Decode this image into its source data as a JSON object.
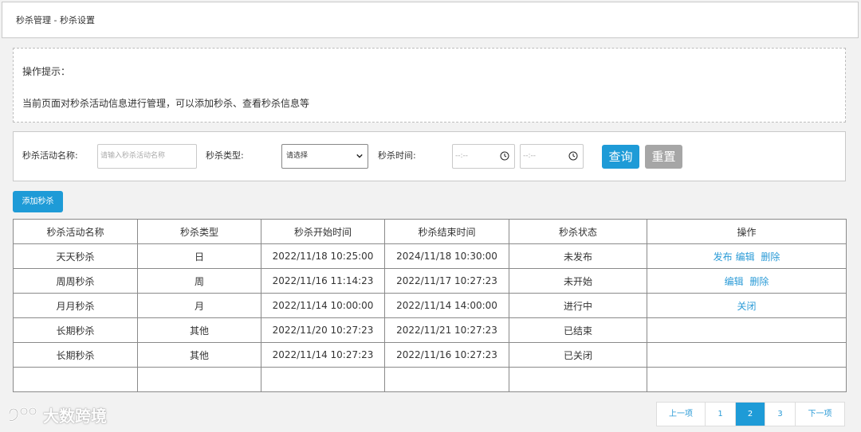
{
  "breadcrumb": "秒杀管理 - 秒杀设置",
  "tips": {
    "title": "操作提示：",
    "text": "当前页面对秒杀活动信息进行管理，可以添加秒杀、查看秒杀信息等"
  },
  "filter": {
    "name_label": "秒杀活动名称:",
    "name_placeholder": "请输入秒杀活动名称",
    "type_label": "秒杀类型:",
    "type_selected": "请选择",
    "time_label": "秒杀时间:",
    "time_start_placeholder": "--:--",
    "time_end_placeholder": "--:--",
    "query_label": "查询",
    "reset_label": "重置"
  },
  "add_button": "添加秒杀",
  "table": {
    "headers": [
      "秒杀活动名称",
      "秒杀类型",
      "秒杀开始时间",
      "秒杀结束时间",
      "秒杀状态",
      "操作"
    ],
    "rows": [
      {
        "name": "天天秒杀",
        "type": "日",
        "start": "2022/11/18 10:25:00",
        "end": "2024/11/18 10:30:00",
        "status": "未发布",
        "actions": [
          "发布",
          "编辑",
          "删除"
        ]
      },
      {
        "name": "周周秒杀",
        "type": "周",
        "start": "2022/11/16 11:14:23",
        "end": "2022/11/17 10:27:23",
        "status": "未开始",
        "actions": [
          "编辑",
          "删除"
        ]
      },
      {
        "name": "月月秒杀",
        "type": "月",
        "start": "2022/11/14 10:00:00",
        "end": "2022/11/14 14:00:00",
        "status": "进行中",
        "actions": [
          "关闭"
        ]
      },
      {
        "name": "长期秒杀",
        "type": "其他",
        "start": "2022/11/20 10:27:23",
        "end": "2022/11/21 10:27:23",
        "status": "已结束",
        "actions": []
      },
      {
        "name": "长期秒杀",
        "type": "其他",
        "start": "2022/11/14 10:27:23",
        "end": "2022/11/16 10:27:23",
        "status": "已关闭",
        "actions": []
      },
      {
        "name": "",
        "type": "",
        "start": "",
        "end": "",
        "status": "",
        "actions": []
      }
    ]
  },
  "pagination": {
    "prev": "上一项",
    "pages": [
      "1",
      "2",
      "3"
    ],
    "current": "2",
    "next": "下一项"
  },
  "watermark": "大数跨境",
  "colors": {
    "accent": "#1e9bd7",
    "link": "#2b9bd7",
    "reset": "#a6a6a6"
  }
}
